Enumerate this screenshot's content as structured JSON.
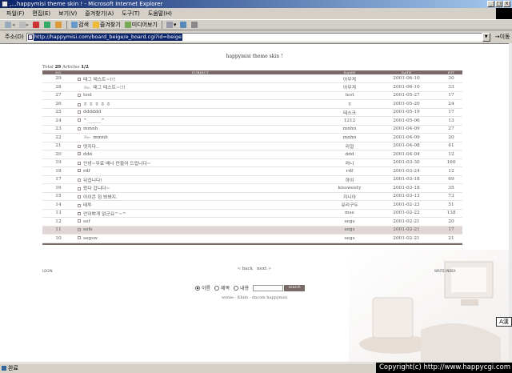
{
  "window": {
    "title": ",...happymisi theme skin ! - Microsoft Internet Explorer"
  },
  "menu": [
    "파일(F)",
    "편집(E)",
    "보기(V)",
    "즐겨찾기(A)",
    "도구(T)",
    "도움말(H)"
  ],
  "toolbar": {
    "search": "검색",
    "favorites": "즐겨찾기",
    "media": "미디어보기"
  },
  "address": {
    "label": "주소(D)",
    "url": "http://happymisi.com/board_beige/e_board.cgi?id=beige",
    "go": "이동"
  },
  "board": {
    "page_title": "happymisi theme skin !",
    "total_label": "Total",
    "total_count": "29",
    "articles_label": "Articles",
    "page": "1/2",
    "columns": [
      "NO",
      "SUBJECT",
      "NAME",
      "DATE",
      "HIT"
    ],
    "rows": [
      {
        "no": "29",
        "subject": "태그 테스트~!!!",
        "reply": false,
        "name": "아무게",
        "date": "2001-06-10",
        "hit": "30"
      },
      {
        "no": "28",
        "subject": "태그 테스트~!!!",
        "reply": true,
        "name": "아무게",
        "date": "2001-06-10",
        "hit": "33"
      },
      {
        "no": "27",
        "subject": "test",
        "reply": false,
        "name": "test",
        "date": "2001-05-27",
        "hit": "17"
      },
      {
        "no": "26",
        "subject": "ㅎ ㅎ ㅎ ㅎ ㅎ",
        "reply": false,
        "name": "ㅎ",
        "date": "2001-05-20",
        "hit": "24"
      },
      {
        "no": "25",
        "subject": "dddddd",
        "reply": false,
        "name": "테스크",
        "date": "2001-05-19",
        "hit": "17"
      },
      {
        "no": "24",
        "subject": "^______^",
        "reply": false,
        "name": "1212",
        "date": "2001-05-06",
        "hit": "13"
      },
      {
        "no": "23",
        "subject": "mmnh",
        "reply": false,
        "name": "mnhn",
        "date": "2001-04-09",
        "hit": "27"
      },
      {
        "no": "22",
        "subject": "mmnh",
        "reply": true,
        "name": "mnhn",
        "date": "2001-04-09",
        "hit": "20"
      },
      {
        "no": "21",
        "subject": "멋지다..",
        "reply": false,
        "name": "리얼",
        "date": "2001-04-08",
        "hit": "41"
      },
      {
        "no": "20",
        "subject": "ddd",
        "reply": false,
        "name": "ddd",
        "date": "2001-04-04",
        "hit": "12"
      },
      {
        "no": "19",
        "subject": "안녕~무료 배너 만들어 드립니다~",
        "reply": false,
        "name": "러니",
        "date": "2001-03-30",
        "hit": "160"
      },
      {
        "no": "18",
        "subject": "rdf",
        "reply": false,
        "name": "rdf",
        "date": "2001-03-24",
        "hit": "12"
      },
      {
        "no": "17",
        "subject": "뒤집니다!",
        "reply": false,
        "name": "하야",
        "date": "2001-03-18",
        "hit": "69"
      },
      {
        "no": "16",
        "subject": "왔다 갑니다~",
        "reply": false,
        "name": "kissweety",
        "date": "2001-03-18",
        "hit": "35"
      },
      {
        "no": "15",
        "subject": "아이콘 점 봐봐지.",
        "reply": false,
        "name": "지니아",
        "date": "2001-03-13",
        "hit": "73"
      },
      {
        "no": "14",
        "subject": "테투",
        "reply": false,
        "name": "유리구두",
        "date": "2001-02-23",
        "hit": "51"
      },
      {
        "no": "13",
        "subject": "안이쁘게 없군요^~^",
        "reply": false,
        "name": "mse",
        "date": "2001-02-22",
        "hit": "138"
      },
      {
        "no": "12",
        "subject": "sef",
        "reply": false,
        "name": "segs",
        "date": "2001-02-21",
        "hit": "20"
      },
      {
        "no": "11",
        "subject": "sefs",
        "reply": false,
        "name": "segs",
        "date": "2001-02-21",
        "hit": "17"
      },
      {
        "no": "10",
        "subject": "segsw",
        "reply": false,
        "name": "segs",
        "date": "2001-02-21",
        "hit": "21"
      }
    ],
    "selected_row": 18,
    "reply_marker": "Re:",
    "login": "LOGIN",
    "write_links": "WRITE  INDEX",
    "pager_back": "back",
    "pager_next": "next",
    "search_options": [
      "이름",
      "제목",
      "내용"
    ],
    "search_button": "search",
    "credits": "wonie - Khim - dacom happymisi"
  },
  "lang_badge": "A漢",
  "status": {
    "text": "완료"
  },
  "watermark": "Copyright(c) http://www.happycgi.com"
}
